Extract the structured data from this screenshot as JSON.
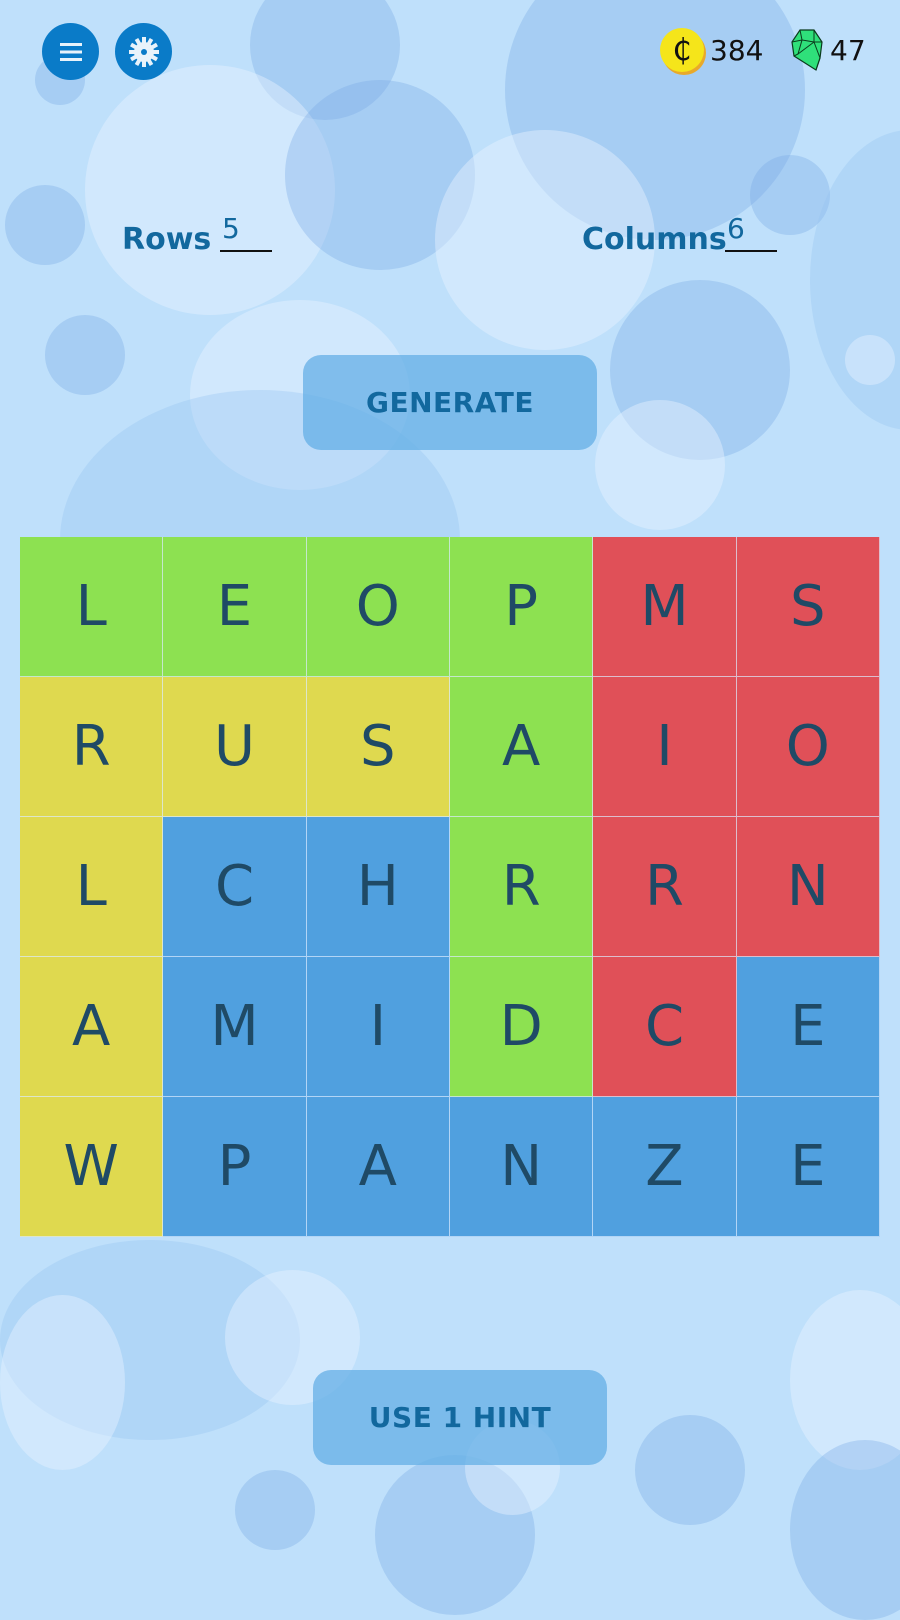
{
  "header": {
    "menu_icon": "hamburger-menu-icon",
    "settings_icon": "gear-icon",
    "coins": {
      "icon": "coin-icon",
      "symbol": "₵",
      "value": "384"
    },
    "gems": {
      "icon": "gem-icon",
      "value": "47"
    }
  },
  "settings": {
    "rows_label": "Rows",
    "rows_value": "5",
    "columns_label": "Columns",
    "columns_value": "6"
  },
  "buttons": {
    "generate_label": "GENERATE",
    "hint_label": "USE 1 HINT"
  },
  "colors": {
    "green": "#8de151",
    "red": "#e05058",
    "yellow": "#dfd94f",
    "blue": "#50a0df",
    "button_blue": "#0a7bc8",
    "text_blue": "#12689e"
  },
  "grid": {
    "rows": [
      {
        "cells": [
          {
            "letter": "L",
            "color": "green"
          },
          {
            "letter": "E",
            "color": "green"
          },
          {
            "letter": "O",
            "color": "green"
          },
          {
            "letter": "P",
            "color": "green"
          },
          {
            "letter": "M",
            "color": "red"
          },
          {
            "letter": "S",
            "color": "red"
          }
        ]
      },
      {
        "cells": [
          {
            "letter": "R",
            "color": "yellow"
          },
          {
            "letter": "U",
            "color": "yellow"
          },
          {
            "letter": "S",
            "color": "yellow"
          },
          {
            "letter": "A",
            "color": "green"
          },
          {
            "letter": "I",
            "color": "red"
          },
          {
            "letter": "O",
            "color": "red"
          }
        ]
      },
      {
        "cells": [
          {
            "letter": "L",
            "color": "yellow"
          },
          {
            "letter": "C",
            "color": "blue"
          },
          {
            "letter": "H",
            "color": "blue"
          },
          {
            "letter": "R",
            "color": "green"
          },
          {
            "letter": "R",
            "color": "red"
          },
          {
            "letter": "N",
            "color": "red"
          }
        ]
      },
      {
        "cells": [
          {
            "letter": "A",
            "color": "yellow"
          },
          {
            "letter": "M",
            "color": "blue"
          },
          {
            "letter": "I",
            "color": "blue"
          },
          {
            "letter": "D",
            "color": "green"
          },
          {
            "letter": "C",
            "color": "red"
          },
          {
            "letter": "E",
            "color": "blue"
          }
        ]
      },
      {
        "cells": [
          {
            "letter": "W",
            "color": "yellow"
          },
          {
            "letter": "P",
            "color": "blue"
          },
          {
            "letter": "A",
            "color": "blue"
          },
          {
            "letter": "N",
            "color": "blue"
          },
          {
            "letter": "Z",
            "color": "blue"
          },
          {
            "letter": "E",
            "color": "blue"
          }
        ]
      }
    ]
  }
}
